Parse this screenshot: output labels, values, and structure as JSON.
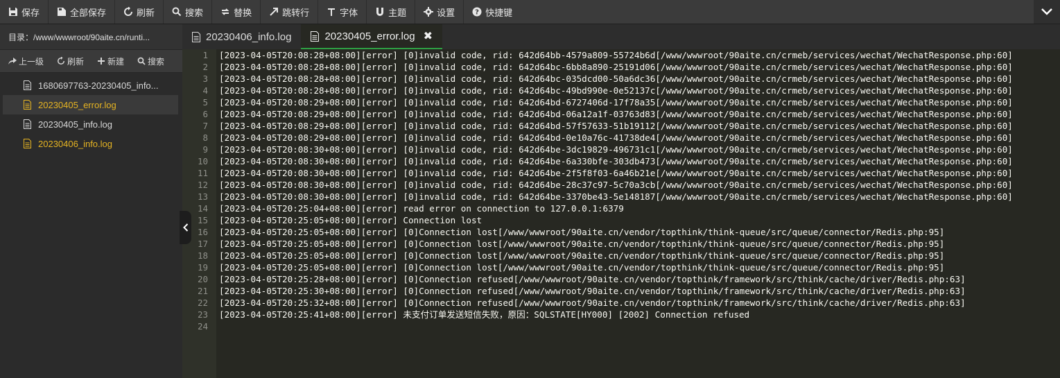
{
  "toolbar": {
    "buttons": [
      {
        "label": "保存",
        "icon": "save-icon"
      },
      {
        "label": "全部保存",
        "icon": "save-all-icon"
      },
      {
        "label": "刷新",
        "icon": "refresh-icon"
      },
      {
        "label": "搜索",
        "icon": "search-icon"
      },
      {
        "label": "替换",
        "icon": "replace-icon"
      },
      {
        "label": "跳转行",
        "icon": "goto-line-icon"
      },
      {
        "label": "字体",
        "icon": "font-icon"
      },
      {
        "label": "主题",
        "icon": "theme-icon"
      },
      {
        "label": "设置",
        "icon": "gear-icon"
      },
      {
        "label": "快捷键",
        "icon": "help-icon"
      }
    ],
    "collapse_icon": "chevron-down-icon"
  },
  "sidebar": {
    "path": "目录：/www/wwwroot/90aite.cn/runti...",
    "actions": [
      {
        "label": "上一级",
        "icon": "share-arrow-icon"
      },
      {
        "label": "刷新",
        "icon": "refresh-icon"
      },
      {
        "label": "新建",
        "icon": "plus-icon"
      },
      {
        "label": "搜索",
        "icon": "search-icon"
      }
    ],
    "files": [
      {
        "name": "1680697763-20230405_info...",
        "state": "normal"
      },
      {
        "name": "20230405_error.log",
        "state": "active"
      },
      {
        "name": "20230405_info.log",
        "state": "normal"
      },
      {
        "name": "20230406_info.log",
        "state": "modified"
      }
    ]
  },
  "tabs": [
    {
      "label": "20230406_info.log",
      "active": false
    },
    {
      "label": "20230405_error.log",
      "active": true,
      "close": "✖"
    }
  ],
  "editor": {
    "cursor_line": 9,
    "line_numbers": [
      "1",
      "2",
      "3",
      "4",
      "5",
      "6",
      "7",
      "8",
      "9",
      "10",
      "11",
      "12",
      "13",
      "14",
      "15",
      "16",
      "17",
      "18",
      "19",
      "20",
      "21",
      "22",
      "23",
      "24"
    ],
    "lines": [
      "[2023-04-05T20:08:28+08:00][error] [0]invalid code, rid: 642d64bb-4579a809-55724b6d[/www/wwwroot/90aite.cn/crmeb/services/wechat/WechatResponse.php:60]",
      "[2023-04-05T20:08:28+08:00][error] [0]invalid code, rid: 642d64bc-6bb8a890-25191d06[/www/wwwroot/90aite.cn/crmeb/services/wechat/WechatResponse.php:60]",
      "[2023-04-05T20:08:28+08:00][error] [0]invalid code, rid: 642d64bc-035dcd00-50a6dc36[/www/wwwroot/90aite.cn/crmeb/services/wechat/WechatResponse.php:60]",
      "[2023-04-05T20:08:28+08:00][error] [0]invalid code, rid: 642d64bc-49bd990e-0e52137c[/www/wwwroot/90aite.cn/crmeb/services/wechat/WechatResponse.php:60]",
      "[2023-04-05T20:08:29+08:00][error] [0]invalid code, rid: 642d64bd-6727406d-17f78a35[/www/wwwroot/90aite.cn/crmeb/services/wechat/WechatResponse.php:60]",
      "[2023-04-05T20:08:29+08:00][error] [0]invalid code, rid: 642d64bd-06a12a1f-03763d83[/www/wwwroot/90aite.cn/crmeb/services/wechat/WechatResponse.php:60]",
      "[2023-04-05T20:08:29+08:00][error] [0]invalid code, rid: 642d64bd-57f57633-51b19112[/www/wwwroot/90aite.cn/crmeb/services/wechat/WechatResponse.php:60]",
      "[2023-04-05T20:08:29+08:00][error] [0]invalid code, rid: 642d64bd-0e10a76c-41738de4[/www/wwwroot/90aite.cn/crmeb/services/wechat/WechatResponse.php:60]",
      "[2023-04-05T20:08:30+08:00][error] [0]invalid code, rid: 642d64be-3dc19829-496731c1[/www/wwwroot/90aite.cn/crmeb/services/wechat/WechatResponse.php:60]",
      "[2023-04-05T20:08:30+08:00][error] [0]invalid code, rid: 642d64be-6a330bfe-303db473[/www/wwwroot/90aite.cn/crmeb/services/wechat/WechatResponse.php:60]",
      "[2023-04-05T20:08:30+08:00][error] [0]invalid code, rid: 642d64be-2f5f8f03-6a46b21e[/www/wwwroot/90aite.cn/crmeb/services/wechat/WechatResponse.php:60]",
      "[2023-04-05T20:08:30+08:00][error] [0]invalid code, rid: 642d64be-28c37c97-5c70a3cb[/www/wwwroot/90aite.cn/crmeb/services/wechat/WechatResponse.php:60]",
      "[2023-04-05T20:08:30+08:00][error] [0]invalid code, rid: 642d64be-3370be43-5e148187[/www/wwwroot/90aite.cn/crmeb/services/wechat/WechatResponse.php:60]",
      "[2023-04-05T20:25:04+08:00][error] read error on connection to 127.0.0.1:6379",
      "[2023-04-05T20:25:05+08:00][error] Connection lost",
      "[2023-04-05T20:25:05+08:00][error] [0]Connection lost[/www/wwwroot/90aite.cn/vendor/topthink/think-queue/src/queue/connector/Redis.php:95]",
      "[2023-04-05T20:25:05+08:00][error] [0]Connection lost[/www/wwwroot/90aite.cn/vendor/topthink/think-queue/src/queue/connector/Redis.php:95]",
      "[2023-04-05T20:25:05+08:00][error] [0]Connection lost[/www/wwwroot/90aite.cn/vendor/topthink/think-queue/src/queue/connector/Redis.php:95]",
      "[2023-04-05T20:25:05+08:00][error] [0]Connection lost[/www/wwwroot/90aite.cn/vendor/topthink/think-queue/src/queue/connector/Redis.php:95]",
      "[2023-04-05T20:25:28+08:00][error] [0]Connection refused[/www/wwwroot/90aite.cn/vendor/topthink/framework/src/think/cache/driver/Redis.php:63]",
      "[2023-04-05T20:25:30+08:00][error] [0]Connection refused[/www/wwwroot/90aite.cn/vendor/topthink/framework/src/think/cache/driver/Redis.php:63]",
      "[2023-04-05T20:25:32+08:00][error] [0]Connection refused[/www/wwwroot/90aite.cn/vendor/topthink/framework/src/think/cache/driver/Redis.php:63]",
      "[2023-04-05T20:25:41+08:00][error] 未支付订单发送短信失败，原因：SQLSTATE[HY000] [2002] Connection refused",
      ""
    ]
  }
}
